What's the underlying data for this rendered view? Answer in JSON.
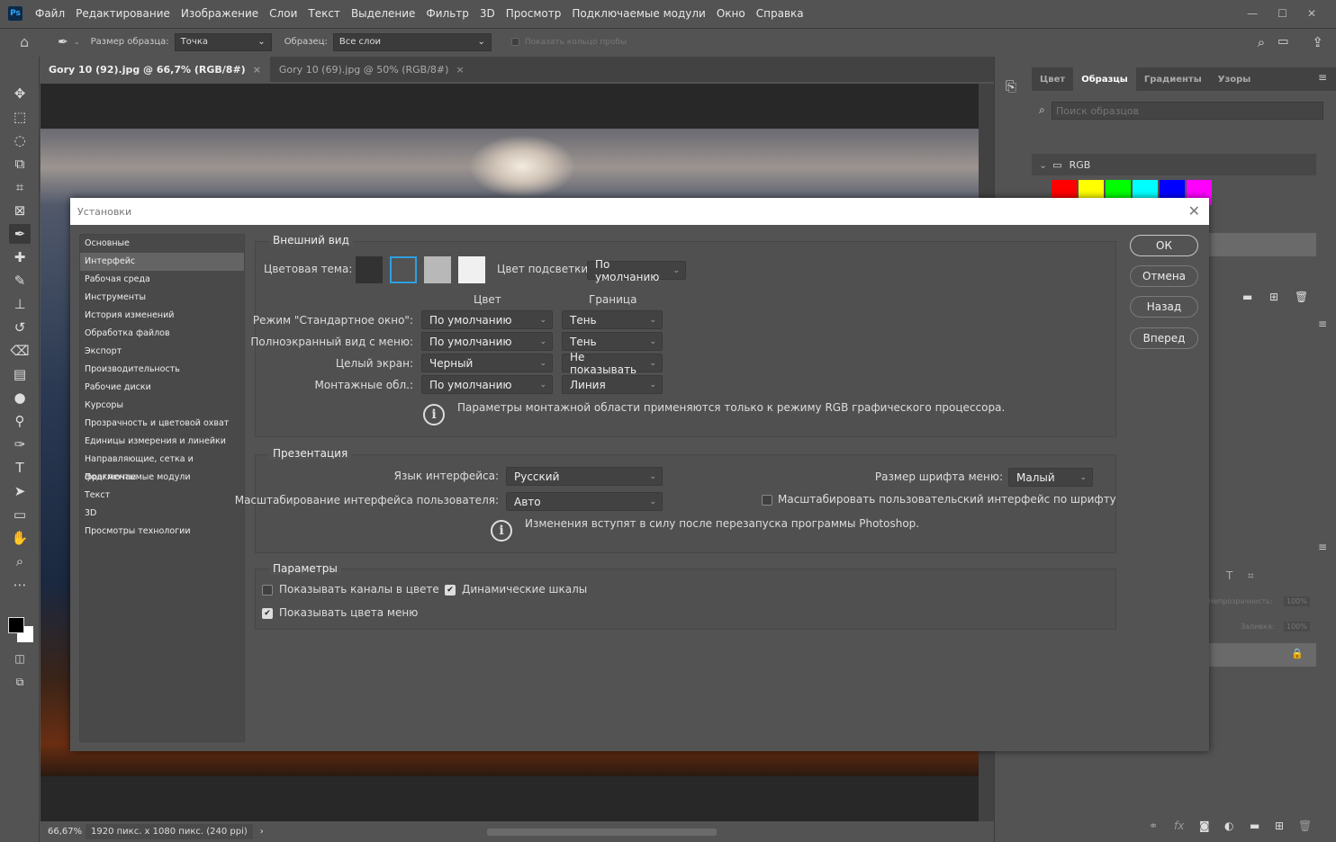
{
  "app": {
    "logo": "Ps",
    "menu": [
      "Файл",
      "Редактирование",
      "Изображение",
      "Слои",
      "Текст",
      "Выделение",
      "Фильтр",
      "3D",
      "Просмотр",
      "Подключаемые модули",
      "Окно",
      "Справка"
    ]
  },
  "options": {
    "sample_size_label": "Размер образца:",
    "sample_size_value": "Точка",
    "sample_label": "Образец:",
    "sample_value": "Все слои",
    "show_ring": "Показать кольцо пробы"
  },
  "tabs": [
    {
      "label": "Gory 10 (92).jpg @ 66,7% (RGB/8#)",
      "active": true
    },
    {
      "label": "Gory 10 (69).jpg @ 50% (RGB/8#)",
      "active": false
    }
  ],
  "status": {
    "zoom": "66,67%",
    "info": "1920 пикс. x 1080 пикс. (240 ppi)"
  },
  "right_panel": {
    "tabs": [
      "Цвет",
      "Образцы",
      "Градиенты",
      "Узоры"
    ],
    "active_tab": "Образцы",
    "search_placeholder": "Поиск образцов",
    "group": "RGB",
    "swatches": [
      "#ff0000",
      "#ffff00",
      "#00ff00",
      "#00ffff",
      "#0000ff",
      "#ff00ff"
    ],
    "opacity_label": "Непрозрачность:",
    "opacity_value": "100%",
    "fill_label": "Заливка:",
    "fill_value": "100%"
  },
  "dialog": {
    "title": "Установки",
    "sidebar": [
      "Основные",
      "Интерфейс",
      "Рабочая среда",
      "Инструменты",
      "История изменений",
      "Обработка файлов",
      "Экспорт",
      "Производительность",
      "Рабочие диски",
      "Курсоры",
      "Прозрачность и цветовой охват",
      "Единицы измерения и линейки",
      "Направляющие, сетка и фрагменты",
      "Подключаемые модули",
      "Текст",
      "3D",
      "Просмотры технологии"
    ],
    "sidebar_active": "Интерфейс",
    "buttons": {
      "ok": "ОК",
      "cancel": "Отмена",
      "back": "Назад",
      "forward": "Вперед"
    },
    "appearance": {
      "title": "Внешний вид",
      "theme_label": "Цветовая тема:",
      "theme_colors": [
        "#323232",
        "#535353",
        "#b8b8b8",
        "#f0f0f0"
      ],
      "theme_selected": 2,
      "highlight_label": "Цвет подсветки:",
      "highlight_value": "По умолчанию",
      "col_color": "Цвет",
      "col_border": "Граница",
      "rows": [
        {
          "label": "Режим \"Стандартное окно\":",
          "color": "По умолчанию",
          "border": "Тень"
        },
        {
          "label": "Полноэкранный вид с меню:",
          "color": "По умолчанию",
          "border": "Тень"
        },
        {
          "label": "Целый экран:",
          "color": "Черный",
          "border": "Не показывать"
        },
        {
          "label": "Монтажные обл.:",
          "color": "По умолчанию",
          "border": "Линия"
        }
      ],
      "note": "Параметры монтажной области применяются только к режиму RGB графического процессора."
    },
    "presentation": {
      "title": "Презентация",
      "lang_label": "Язык интерфейса:",
      "lang_value": "Русский",
      "font_label": "Размер шрифта меню:",
      "font_value": "Малый",
      "scale_label": "Масштабирование интерфейса пользователя:",
      "scale_value": "Авто",
      "scale_font_label": "Масштабировать пользовательский интерфейс по шрифту",
      "scale_font_checked": false,
      "note": "Изменения вступят в силу после перезапуска программы Photoshop."
    },
    "params": {
      "title": "Параметры",
      "channels_color": "Показывать каналы в цвете",
      "channels_color_checked": false,
      "dynamic_sliders": "Динамические шкалы",
      "dynamic_sliders_checked": true,
      "menu_colors": "Показывать цвета меню",
      "menu_colors_checked": true
    }
  }
}
